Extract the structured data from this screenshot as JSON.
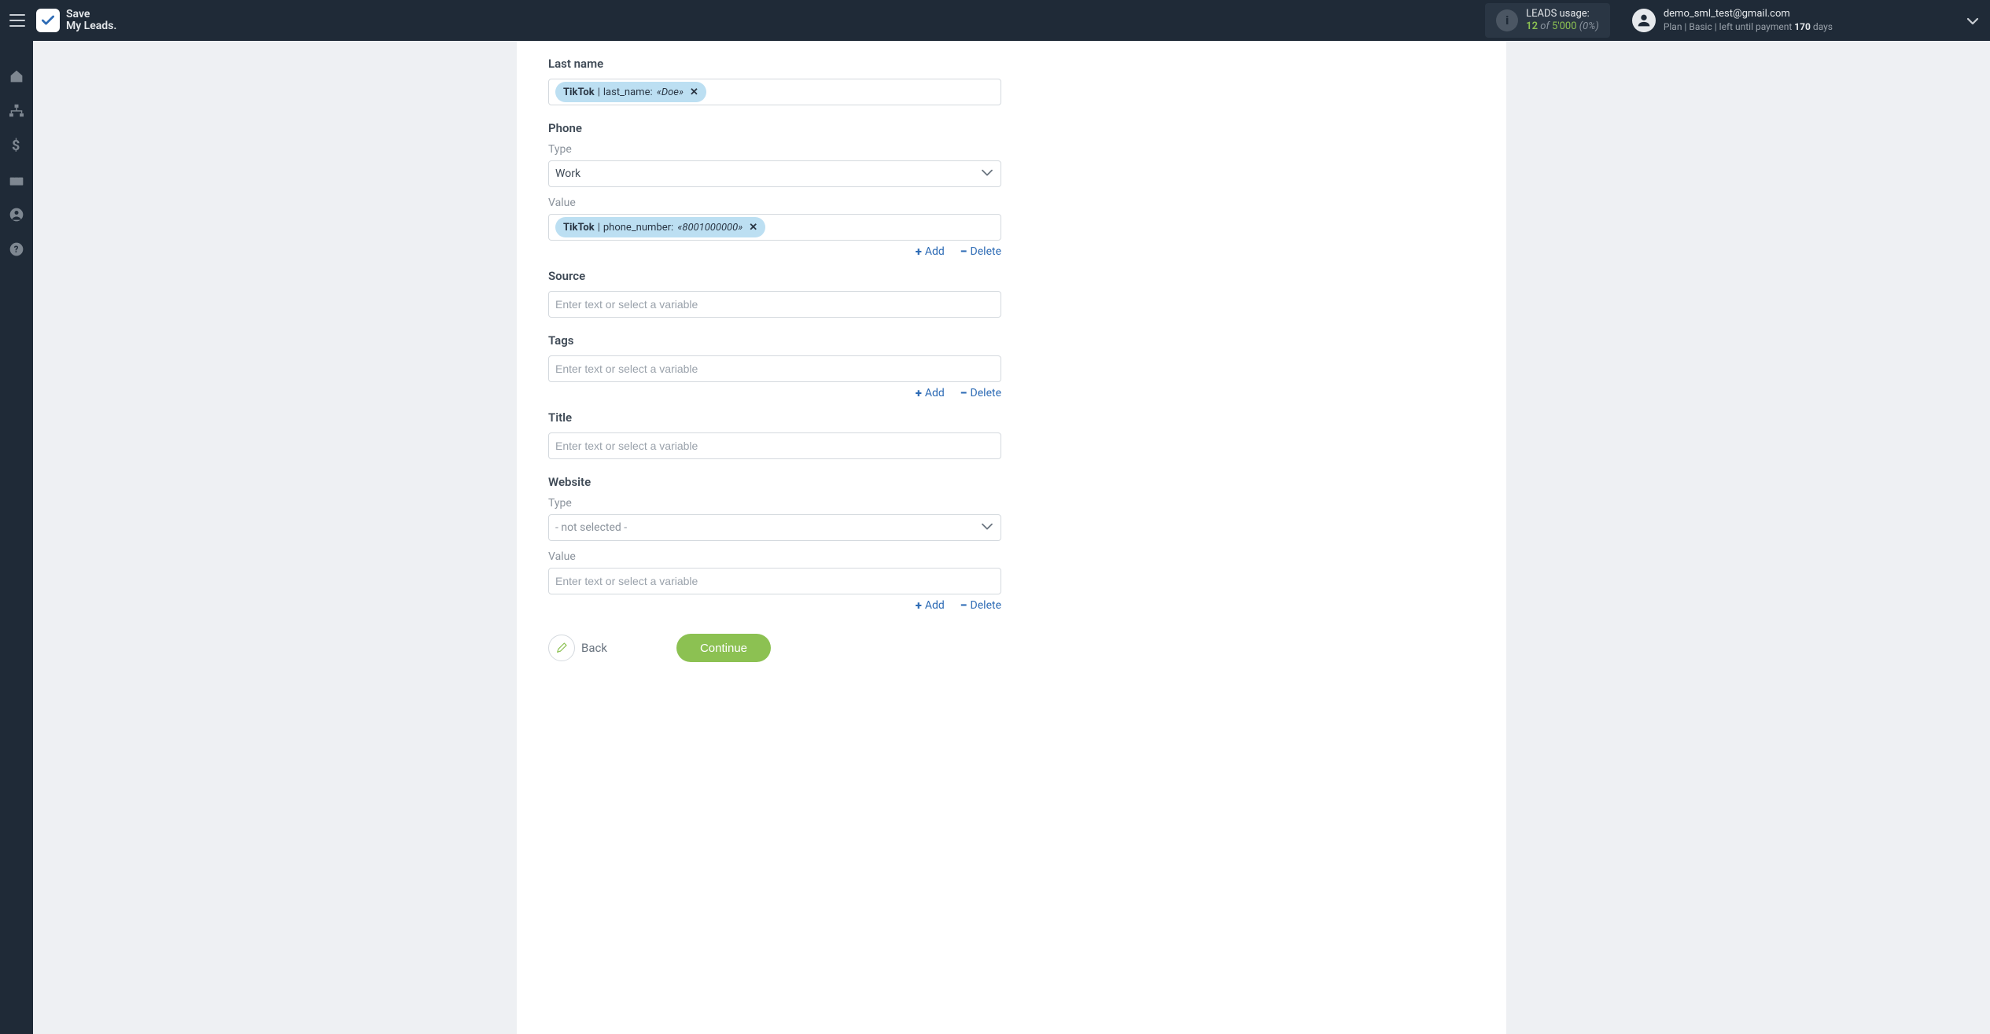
{
  "topbar": {
    "logo_line1": "Save",
    "logo_line2": "My Leads.",
    "usage_title": "LEADS usage:",
    "usage_current": "12",
    "usage_of": "of",
    "usage_total": "5'000",
    "usage_pct": "(0%)",
    "user_email": "demo_sml_test@gmail.com",
    "plan_prefix": "Plan |",
    "plan_name": "Basic",
    "plan_mid": "| left until payment",
    "plan_days_value": "170",
    "plan_days_label": "days"
  },
  "form": {
    "lastname_label": "Last name",
    "lastname_chip_source": "TikTok",
    "lastname_chip_key": "last_name:",
    "lastname_chip_value": "«Doe»",
    "phone_label": "Phone",
    "type_label": "Type",
    "phone_type_value": "Work",
    "value_label": "Value",
    "phone_value_chip_source": "TikTok",
    "phone_value_chip_key": "phone_number:",
    "phone_value_chip_value": "«8001000000»",
    "add_label": "Add",
    "delete_label": "Delete",
    "source_label": "Source",
    "tags_label": "Tags",
    "title_label": "Title",
    "website_label": "Website",
    "website_type_value": "- not selected -",
    "placeholder": "Enter text or select a variable",
    "back_label": "Back",
    "continue_label": "Continue"
  }
}
